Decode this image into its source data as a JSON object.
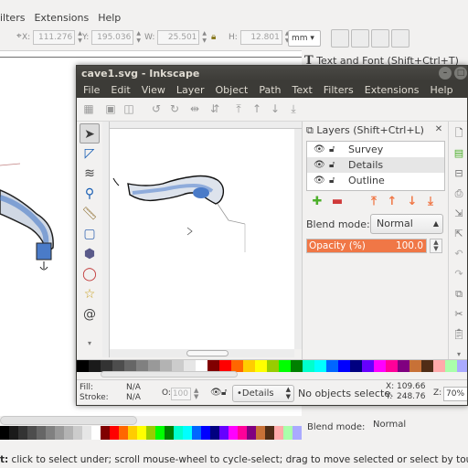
{
  "background_window": {
    "menubar": [
      "ilters",
      "Extensions",
      "Help"
    ],
    "toolbar": {
      "x": {
        "label": "X:",
        "value": "111.276"
      },
      "y": {
        "label": "Y:",
        "value": "195.036"
      },
      "w": {
        "label": "W:",
        "value": "25.501"
      },
      "h": {
        "label": "H:",
        "value": "12.801"
      },
      "unit": "mm"
    },
    "text_font_panel": "Text and Font (Shift+Ctrl+T)",
    "blend_label": "Blend mode:",
    "blend_value": "Normal",
    "status_prefix": "t:",
    "status_text": " click to select under; scroll mouse-wheel to cycle-select; drag to move selected or select by touch"
  },
  "window": {
    "title": "cave1.svg - Inkscape",
    "menu": [
      "File",
      "Edit",
      "View",
      "Layer",
      "Object",
      "Path",
      "Text",
      "Filters",
      "Extensions",
      "Help"
    ]
  },
  "tools": [
    "selector-tool",
    "node-tool",
    "tweak-tool",
    "zoom-tool",
    "measure-tool",
    "rectangle-tool",
    "3d-box-tool",
    "ellipse-tool",
    "star-tool",
    "spiral-tool"
  ],
  "layers_panel": {
    "title": "Layers (Shift+Ctrl+L)",
    "layers": [
      {
        "name": "Survey",
        "selected": false
      },
      {
        "name": "Details",
        "selected": true
      },
      {
        "name": "Outline",
        "selected": false
      }
    ],
    "blend_label": "Blend mode:",
    "blend_value": "Normal",
    "opacity_label": "Opacity (%)",
    "opacity_value": "100.0"
  },
  "statusbar": {
    "fill_label": "Fill:",
    "fill_value": "N/A",
    "stroke_label": "Stroke:",
    "stroke_value": "N/A",
    "opacity_label": "O:",
    "opacity_value": "100",
    "current_layer": "•Details",
    "message": "No objects selecte.",
    "x_label": "X:",
    "x_value": "109.66",
    "y_label": "Y:",
    "y_value": "248.76",
    "zoom_label": "Z:",
    "zoom_value": "70%"
  },
  "palette": [
    "#000000",
    "#1a1a1a",
    "#333333",
    "#4d4d4d",
    "#666666",
    "#808080",
    "#999999",
    "#b3b3b3",
    "#cccccc",
    "#e6e6e6",
    "#ffffff",
    "#800000",
    "#ff0000",
    "#ff6600",
    "#ffcc00",
    "#ffff00",
    "#99cc00",
    "#00ff00",
    "#008000",
    "#00ffcc",
    "#00ffff",
    "#0066ff",
    "#0000ff",
    "#000080",
    "#6600ff",
    "#ff00ff",
    "#ff0099",
    "#800080",
    "#c87137",
    "#502d16",
    "#ffaaaa",
    "#aaffaa",
    "#aaaaff"
  ],
  "colors": {
    "title_bar": "#3c3b37",
    "menu_text": "#dfdbd2",
    "accent": "#f07746",
    "cave_fill": "#4a7bc8",
    "canvas": "#ffffff"
  }
}
